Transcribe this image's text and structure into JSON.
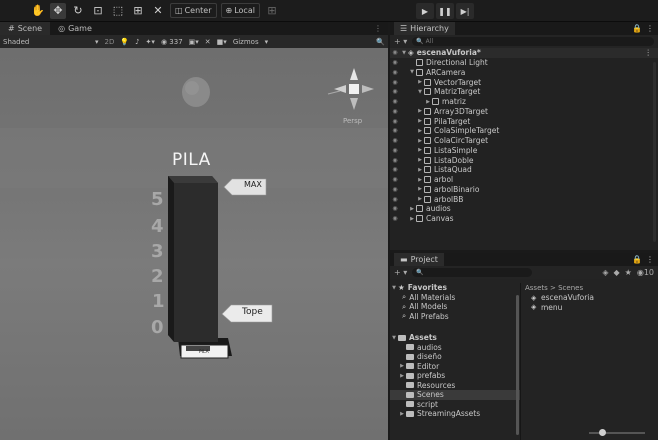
{
  "toolbar": {
    "center_label": "Center",
    "local_label": "Local"
  },
  "scene": {
    "tabs": [
      "Scene",
      "Game"
    ],
    "shading": "Shaded",
    "mode_2d": "2D",
    "counter": "337",
    "gizmos_label": "Gizmos",
    "persp_label": "Persp"
  },
  "viewport": {
    "stack_title": "PILA",
    "marker_label": "PILA",
    "max_label": "MAX",
    "tope_label": "Tope",
    "numbers": [
      "5",
      "4",
      "3",
      "2",
      "1",
      "0"
    ]
  },
  "hierarchy": {
    "tab": "Hierarchy",
    "search_placeholder": "All",
    "root": "escenaVuforia*",
    "items": [
      {
        "label": "Directional Light",
        "depth": 1,
        "arrow": ""
      },
      {
        "label": "ARCamera",
        "depth": 1,
        "arrow": "▼"
      },
      {
        "label": "VectorTarget",
        "depth": 2,
        "arrow": "▶"
      },
      {
        "label": "MatrizTarget",
        "depth": 2,
        "arrow": "▼"
      },
      {
        "label": "matriz",
        "depth": 3,
        "arrow": "▶"
      },
      {
        "label": "Array3DTarget",
        "depth": 2,
        "arrow": "▶"
      },
      {
        "label": "PilaTarget",
        "depth": 2,
        "arrow": "▶"
      },
      {
        "label": "ColaSimpleTarget",
        "depth": 2,
        "arrow": "▶"
      },
      {
        "label": "ColaCircTarget",
        "depth": 2,
        "arrow": "▶"
      },
      {
        "label": "ListaSimple",
        "depth": 2,
        "arrow": "▶"
      },
      {
        "label": "ListaDoble",
        "depth": 2,
        "arrow": "▶"
      },
      {
        "label": "ListaQuad",
        "depth": 2,
        "arrow": "▶"
      },
      {
        "label": "arbol",
        "depth": 2,
        "arrow": "▶"
      },
      {
        "label": "arbolBinario",
        "depth": 2,
        "arrow": "▶"
      },
      {
        "label": "arbolBB",
        "depth": 2,
        "arrow": "▶"
      },
      {
        "label": "audios",
        "depth": 1,
        "arrow": "▶"
      },
      {
        "label": "Canvas",
        "depth": 1,
        "arrow": "▶"
      }
    ]
  },
  "project": {
    "tab": "Project",
    "counter": "10",
    "favorites_label": "Favorites",
    "favorites": [
      "All Materials",
      "All Models",
      "All Prefabs"
    ],
    "assets_label": "Assets",
    "assets": [
      {
        "label": "audios",
        "arrow": ""
      },
      {
        "label": "diseño",
        "arrow": ""
      },
      {
        "label": "Editor",
        "arrow": "▶"
      },
      {
        "label": "prefabs",
        "arrow": "▶"
      },
      {
        "label": "Resources",
        "arrow": ""
      },
      {
        "label": "Scenes",
        "arrow": ""
      },
      {
        "label": "script",
        "arrow": ""
      },
      {
        "label": "StreamingAssets",
        "arrow": "▶"
      }
    ],
    "breadcrumb": "Assets > Scenes",
    "files": [
      "escenaVuforia",
      "menu"
    ]
  }
}
